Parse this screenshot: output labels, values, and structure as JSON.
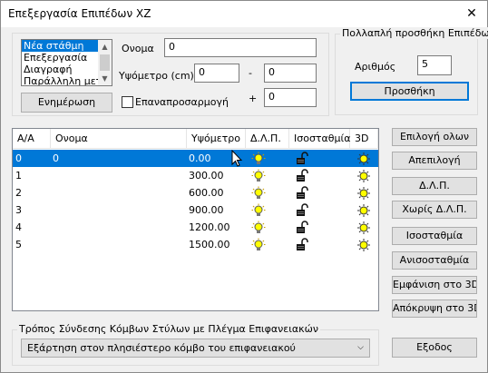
{
  "window": {
    "title": "Επεξεργασία Επιπέδων XZ",
    "close": "✕"
  },
  "levels_list": {
    "items": [
      "Νέα στάθμη",
      "Επεξεργασία",
      "Διαγραφή",
      "Παράλληλη μετα"
    ],
    "selected_index": 0
  },
  "update_button": "Ενημέρωση",
  "name_label": "Ονομα",
  "name_value": "0",
  "height_label": "Υψόμετρο (cm)",
  "height_from": "0",
  "dash": "-",
  "height_to": "0",
  "reposition_label": "Επαναπροσαρμογή",
  "reposition_checked": false,
  "plus": "+",
  "plus_value": "0",
  "multi": {
    "title": "Πολλαπλή προσθήκη Επιπέδων",
    "count_label": "Αριθμός",
    "count_value": "5",
    "add_button": "Προσθήκη"
  },
  "table": {
    "headers": [
      "Α/Α",
      "Ονομα",
      "Υψόμετρο",
      "Δ.Λ.Π.",
      "Ισοσταθμία",
      "3D"
    ],
    "rows": [
      {
        "aa": "0",
        "name": "0",
        "height": "0.00"
      },
      {
        "aa": "1",
        "name": "",
        "height": "300.00"
      },
      {
        "aa": "2",
        "name": "",
        "height": "600.00"
      },
      {
        "aa": "3",
        "name": "",
        "height": "900.00"
      },
      {
        "aa": "4",
        "name": "",
        "height": "1200.00"
      },
      {
        "aa": "5",
        "name": "",
        "height": "1500.00"
      }
    ],
    "selected_row": 0
  },
  "side_buttons": {
    "select_all": "Επιλογή ολων",
    "deselect": "Απεπιλογή",
    "dlp": "Δ.Λ.Π.",
    "no_dlp": "Χωρίς Δ.Λ.Π.",
    "level": "Ισοσταθμία",
    "unlevel": "Ανισοσταθμία",
    "show3d": "Εμφάνιση στο 3D",
    "hide3d": "Απόκρυψη στο 3D",
    "exit": "Εξοδος"
  },
  "connection": {
    "title": "Τρόπος Σύνδεσης Κόμβων Στύλων με Πλέγμα Επιφανειακών",
    "selected": "Εξάρτηση στον πλησιέστερο κόμβο του επιφανειακού"
  },
  "icons": {
    "dlp": "lightbulb-icon",
    "level": "padlock-open-icon",
    "show3d": "sun-icon"
  },
  "colors": {
    "selection": "#0078d7",
    "bulb": "#ffff00",
    "sun": "#ffff00"
  }
}
